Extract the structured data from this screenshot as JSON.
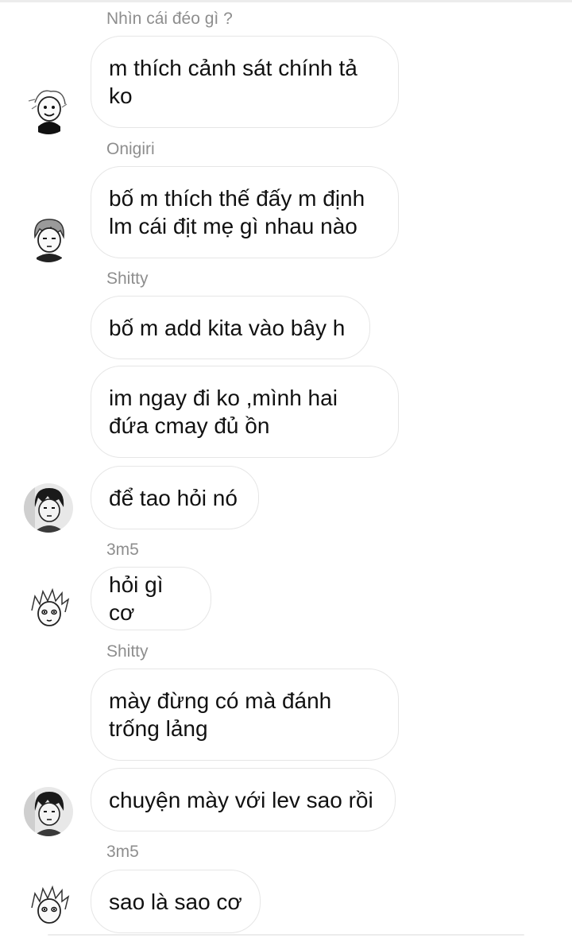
{
  "messages": [
    {
      "sender": "Nhìn cái đéo gì ?",
      "text": "m thích cảnh sát chính tả ko",
      "avatar": "avatar-blond-smiling-icon"
    },
    {
      "sender": "Onigiri",
      "text": "bố m thích thế đấy m định lm cái địt mẹ gì nhau nào",
      "avatar": "avatar-gray-hair-icon"
    },
    {
      "sender": "Shitty",
      "text": "bố m add kita vào bây h"
    },
    {
      "text": "im ngay đi ko ,mình hai đứa cmay đủ ồn"
    },
    {
      "text": "để tao hỏi nó",
      "avatar": "avatar-dark-hair-icon"
    },
    {
      "sender": "3m5",
      "text": "hỏi gì cơ",
      "avatar": "avatar-spiky-blond-icon"
    },
    {
      "sender": "Shitty",
      "text": "mày đừng có mà đánh trống lảng"
    },
    {
      "text": "chuyện mày với lev sao rồi",
      "avatar": "avatar-dark-hair-icon"
    },
    {
      "sender": "3m5",
      "text": "sao là sao cơ",
      "avatar": "avatar-spiky-blond-icon"
    }
  ]
}
